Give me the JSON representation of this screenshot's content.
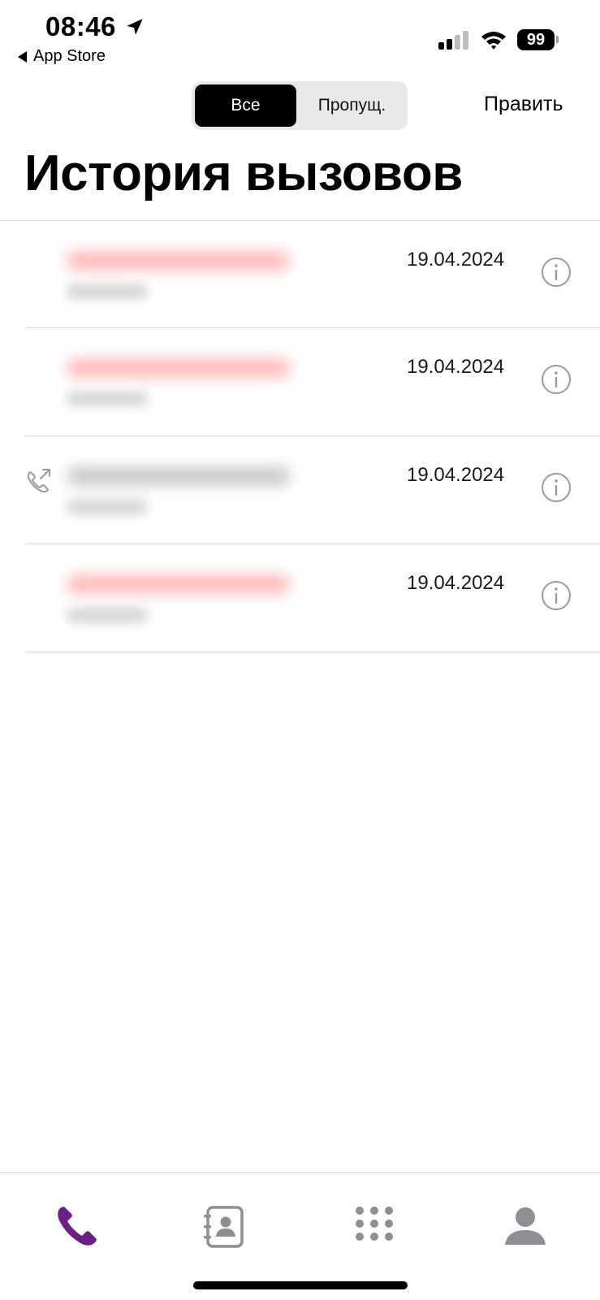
{
  "status_bar": {
    "time": "08:46",
    "back_app_label": "App Store",
    "battery_level": "99"
  },
  "nav": {
    "segments": [
      "Все",
      "Пропущ."
    ],
    "selected_segment": "Все",
    "edit_label": "Править"
  },
  "page_title": "История вызовов",
  "calls": [
    {
      "date": "19.04.2024",
      "missed": true,
      "outgoing": false
    },
    {
      "date": "19.04.2024",
      "missed": true,
      "outgoing": false
    },
    {
      "date": "19.04.2024",
      "missed": false,
      "outgoing": true
    },
    {
      "date": "19.04.2024",
      "missed": true,
      "outgoing": false
    }
  ],
  "tabs": [
    {
      "icon": "phone-icon",
      "active": true
    },
    {
      "icon": "contacts-book-icon",
      "active": false
    },
    {
      "icon": "keypad-icon",
      "active": false
    },
    {
      "icon": "person-icon",
      "active": false
    }
  ],
  "colors": {
    "accent": "#6b1f87",
    "missed_name": "#ffb3b3",
    "icon_gray": "#8e8e93"
  }
}
